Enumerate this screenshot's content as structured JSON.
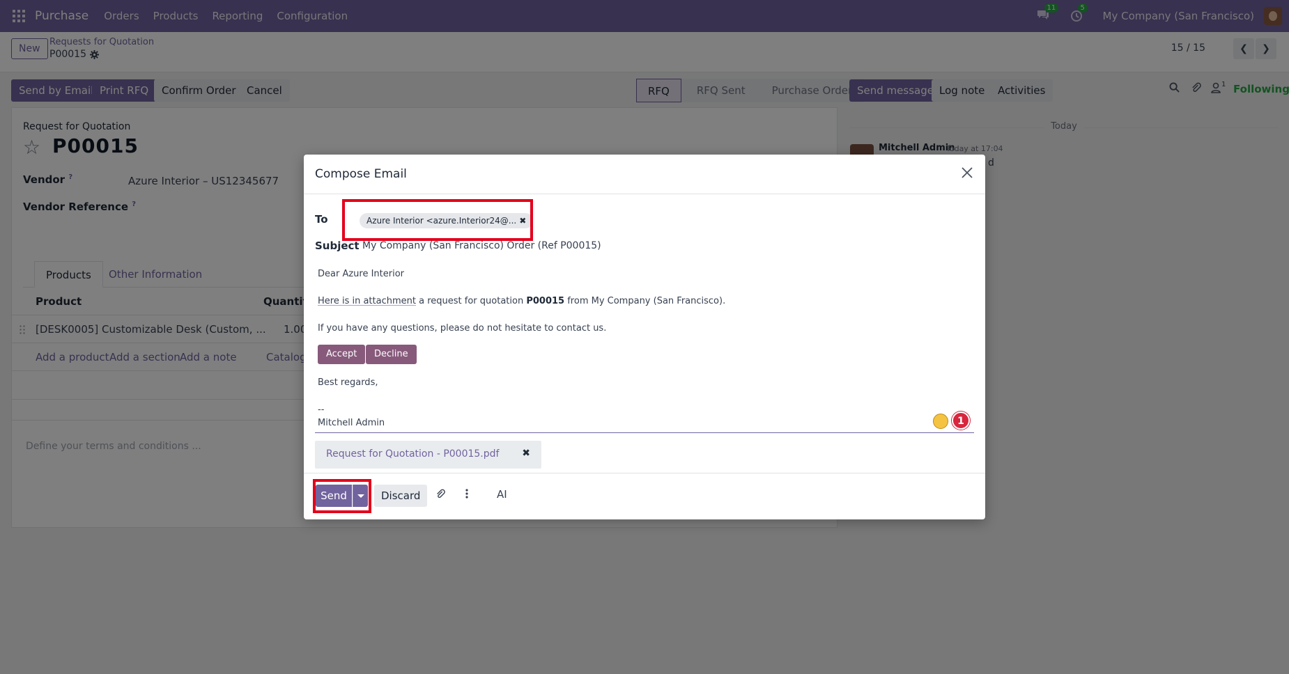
{
  "navbar": {
    "brand": "Purchase",
    "menu": [
      "Orders",
      "Products",
      "Reporting",
      "Configuration"
    ],
    "messages_count": "11",
    "activities_count": "5",
    "company": "My Company (San Francisco)"
  },
  "control_panel": {
    "new_label": "New",
    "breadcrumb_parent": "Requests for Quotation",
    "breadcrumb_current": "P00015",
    "pager": "15 / 15"
  },
  "actions": {
    "send_by_email": "Send by Email",
    "print_rfq": "Print RFQ",
    "confirm_order": "Confirm Order",
    "cancel": "Cancel"
  },
  "statusbar": {
    "stages": [
      "RFQ",
      "RFQ Sent",
      "Purchase Order"
    ],
    "active": "RFQ"
  },
  "chatter": {
    "send_message": "Send message",
    "log_note": "Log note",
    "activities": "Activities",
    "follower_count": "1",
    "following": "Following",
    "today": "Today",
    "author": "Mitchell Admin",
    "time": "Today at 17:04",
    "fragment": "d"
  },
  "form": {
    "subtitle": "Request for Quotation",
    "title": "P00015",
    "vendor_label": "Vendor",
    "vendor_value": "Azure Interior – US12345677",
    "vendor_ref_label": "Vendor Reference",
    "tabs": [
      "Products",
      "Other Information"
    ],
    "table_headers": [
      "Product",
      "Quantity"
    ],
    "row": {
      "product": "[DESK0005] Customizable Desk (Custom, ...",
      "quantity": "1.00"
    },
    "add_links": [
      "Add a product",
      "Add a section",
      "Add a note",
      "Catalog"
    ],
    "terms_placeholder": "Define your terms and conditions ..."
  },
  "modal": {
    "title": "Compose Email",
    "to_label": "To",
    "to_tag": "Azure Interior <azure.Interior24@...",
    "subject_label": "Subject",
    "subject_value": "My Company (San Francisco) Order (Ref P00015)",
    "greeting": "Dear Azure Interior",
    "attachment_link": "Here is in attachment",
    "intro_mid": " a request for quotation ",
    "order_ref": "P00015",
    "intro_end": " from My Company (San Francisco).",
    "questions": "If you have any questions, please do not hesitate to contact us.",
    "accept": "Accept",
    "decline": "Decline",
    "regards": "Best regards,",
    "sig_dash": "--",
    "signature": "Mitchell Admin",
    "badge_count": "1",
    "attachment_name": "Request for Quotation - P00015.pdf",
    "send": "Send",
    "discard": "Discard",
    "ai": "AI"
  },
  "colors": {
    "brand": "#71639e",
    "highlight": "#e3001b",
    "accent_button": "#875a7b"
  }
}
